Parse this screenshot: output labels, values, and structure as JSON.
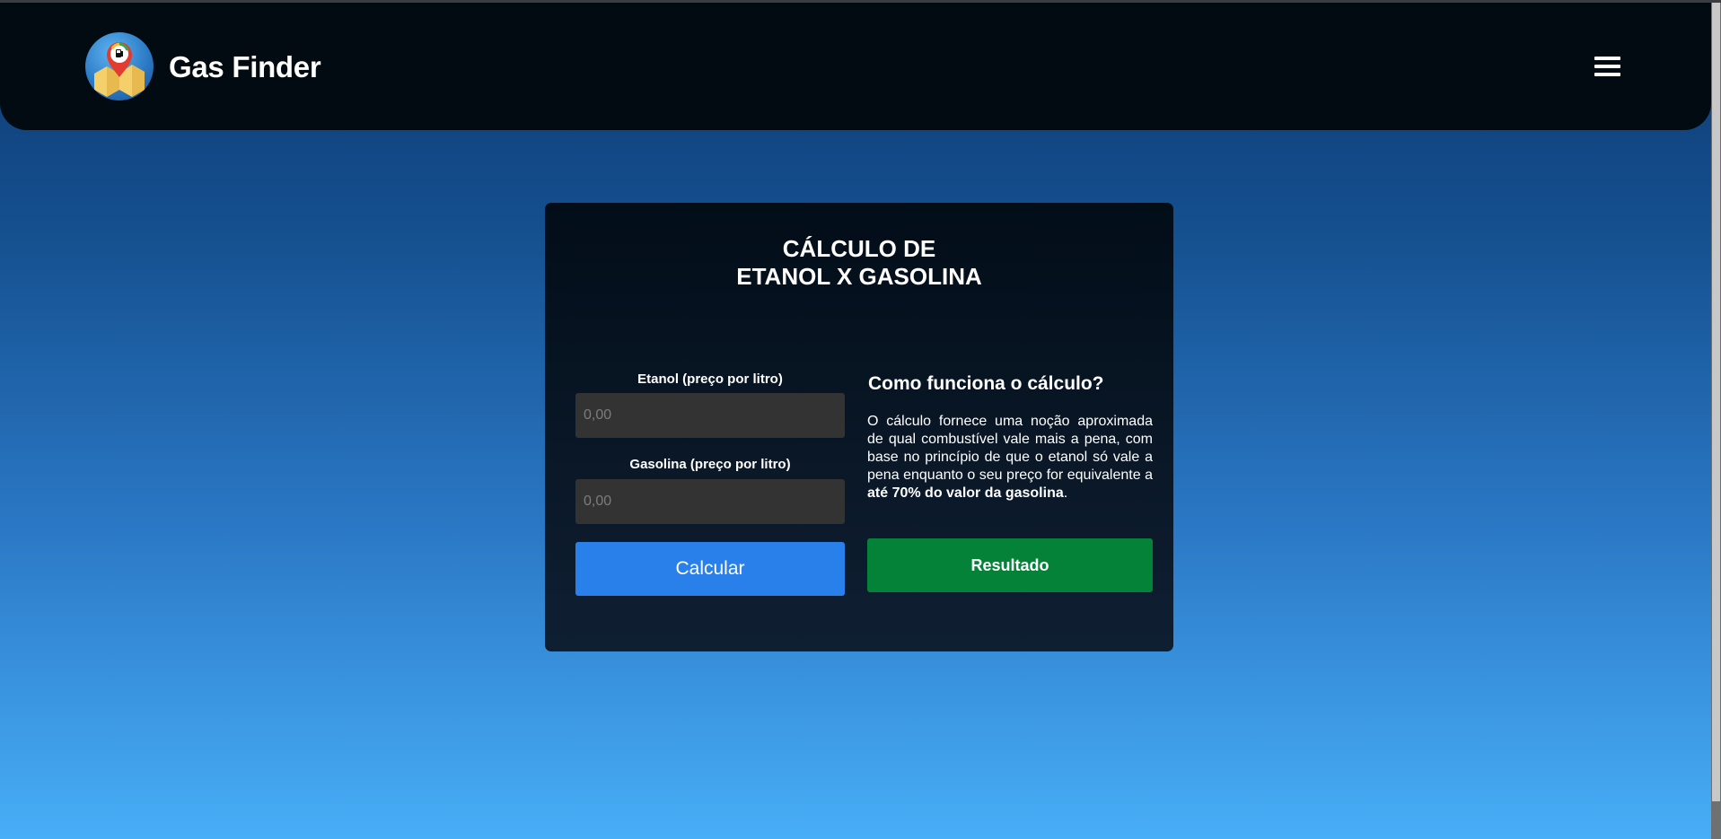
{
  "header": {
    "brand": "Gas Finder",
    "logo_icon": "map-pin-fuel-icon",
    "menu_icon": "hamburger-menu-icon"
  },
  "calculator": {
    "title_line1": "CÁLCULO DE",
    "title_line2": "ETANOL X GASOLINA",
    "etanol_label": "Etanol (preço por litro)",
    "etanol_placeholder": "0,00",
    "gasolina_label": "Gasolina (preço por litro)",
    "gasolina_placeholder": "0,00",
    "calc_button": "Calcular",
    "how_title": "Como funciona o cálculo?",
    "how_text": "O cálculo fornece uma noção aproximada de qual combustível vale mais a pena, com base no princípio de que o etanol só vale a pena enquanto o seu preço for equivalente a ",
    "how_text_bold": "até 70% do valor da gasolina",
    "how_text_end": ".",
    "result_button": "Resultado"
  },
  "colors": {
    "header_bg": "#020a12",
    "calc_button": "#2a80ea",
    "result_button": "#038238",
    "input_bg": "#333333"
  }
}
